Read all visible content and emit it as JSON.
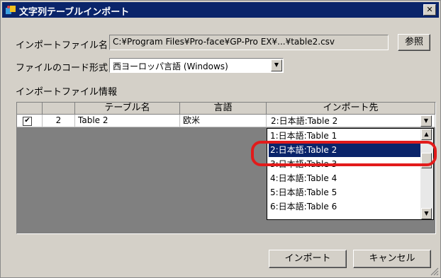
{
  "window": {
    "title": "文字列テーブルインポート",
    "close_label": "✕"
  },
  "form": {
    "file_label": "インポートファイル名",
    "file_value": "C:¥Program Files¥Pro-face¥GP-Pro EX¥...¥table2.csv",
    "browse_label": "参照",
    "code_label": "ファイルのコード形式",
    "code_value": "西ヨーロッパ言語 (Windows)",
    "info_label": "インポートファイル情報"
  },
  "table": {
    "headers": [
      "",
      "",
      "テーブル名",
      "言語",
      "インポート先"
    ],
    "rows": [
      {
        "checked": true,
        "number": "2",
        "name": "Table 2",
        "language": "欧米",
        "destination": "2:日本語:Table 2"
      }
    ]
  },
  "dropdown": {
    "items": [
      "1:日本語:Table 1",
      "2:日本語:Table 2",
      "3:日本語:Table 3",
      "4:日本語:Table 4",
      "5:日本語:Table 5",
      "6:日本語:Table 6"
    ],
    "selected_index": 1
  },
  "buttons": {
    "import_label": "インポート",
    "cancel_label": "キャンセル"
  },
  "colors": {
    "titlebar": "#0a246a",
    "selection": "#0a246a",
    "highlight": "#e21b1b"
  }
}
